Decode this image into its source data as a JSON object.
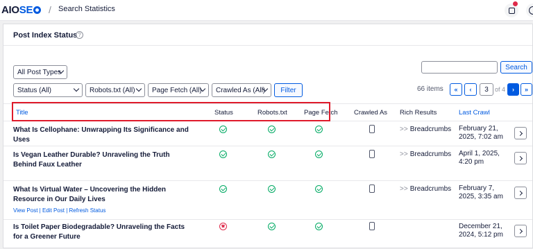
{
  "header": {
    "logo_text_a": "AIO",
    "logo_text_b": "SE",
    "breadcrumb": "Search Statistics",
    "icons": [
      "inbox-icon",
      "help-icon"
    ],
    "brand_color": "#005ae0"
  },
  "card": {
    "title": "Post Index Status",
    "help_icon": "?"
  },
  "filters": {
    "post_types": "All Post Types",
    "status": "Status (All)",
    "robots": "Robots.txt (All)",
    "page_fetch": "Page Fetch (All)",
    "crawled_as": "Crawled As (All)",
    "filter_button": "Filter",
    "search_button": "Search",
    "search_value": ""
  },
  "pagination": {
    "items": "66 items",
    "first": "«",
    "prev": "‹",
    "current": "3",
    "of": "of 4",
    "next": "›",
    "last": "»"
  },
  "table": {
    "columns": [
      "Title",
      "Status",
      "Robots.txt",
      "Page Fetch",
      "Crawled As",
      "Rich Results",
      "Last Crawl"
    ],
    "rows": [
      {
        "title": "What Is Cellophane: Unwrapping Its Significance and Uses",
        "status": "ok",
        "robots": "ok",
        "fetch": "ok",
        "crawled_as": "mobile",
        "rich": "Breadcrumbs",
        "last_crawl": "February 21, 2025, 7:02 am"
      },
      {
        "title": "Is Vegan Leather Durable? Unraveling the Truth Behind Faux Leather",
        "status": "ok",
        "robots": "ok",
        "fetch": "ok",
        "crawled_as": "mobile",
        "rich": "Breadcrumbs",
        "last_crawl": "April 1, 2025, 4:20 pm"
      },
      {
        "title": "What Is Virtual Water – Uncovering the Hidden Resource in Our Daily Lives",
        "actions": "View Post | Edit Post | Refresh Status",
        "status": "ok",
        "robots": "ok",
        "fetch": "ok",
        "crawled_as": "mobile",
        "rich": "Breadcrumbs",
        "last_crawl": "February 7, 2025, 3:35 am"
      },
      {
        "title": "Is Toilet Paper Biodegradable? Unraveling the Facts for a Greener Future",
        "status": "error",
        "robots": "ok",
        "fetch": "ok",
        "crawled_as": "mobile",
        "rich": "",
        "last_crawl": "December 21, 2024, 5:12 pm"
      }
    ]
  }
}
